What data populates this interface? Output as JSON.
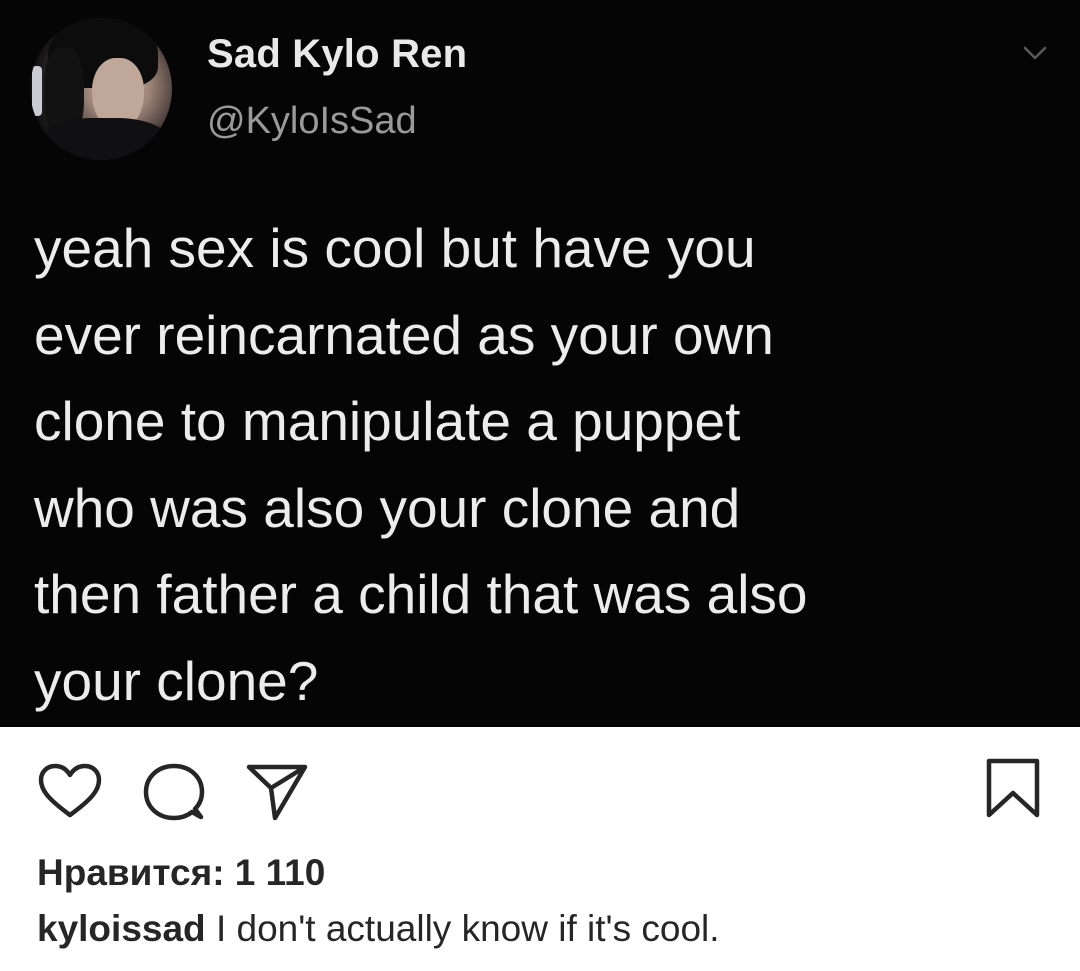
{
  "tweet": {
    "display_name": "Sad Kylo Ren",
    "handle": "@KyloIsSad",
    "text": "yeah sex is cool but have you\never reincarnated as your own\nclone to manipulate a puppet\nwho was also your clone and\nthen father a child that was also\nyour clone?"
  },
  "icons": {
    "like": "heart-icon",
    "comment": "comment-bubble-icon",
    "share": "paper-plane-icon",
    "save": "bookmark-icon",
    "menu": "chevron-down-icon"
  },
  "post": {
    "likes_text": "Нравится: 1 110",
    "caption_user": "kyloissad",
    "caption_text": "I don't actually know if it's cool."
  },
  "colors": {
    "tweet_bg": "#050505",
    "tweet_text": "#ececec",
    "handle": "#9a9a9a",
    "ui_text": "#262626"
  }
}
